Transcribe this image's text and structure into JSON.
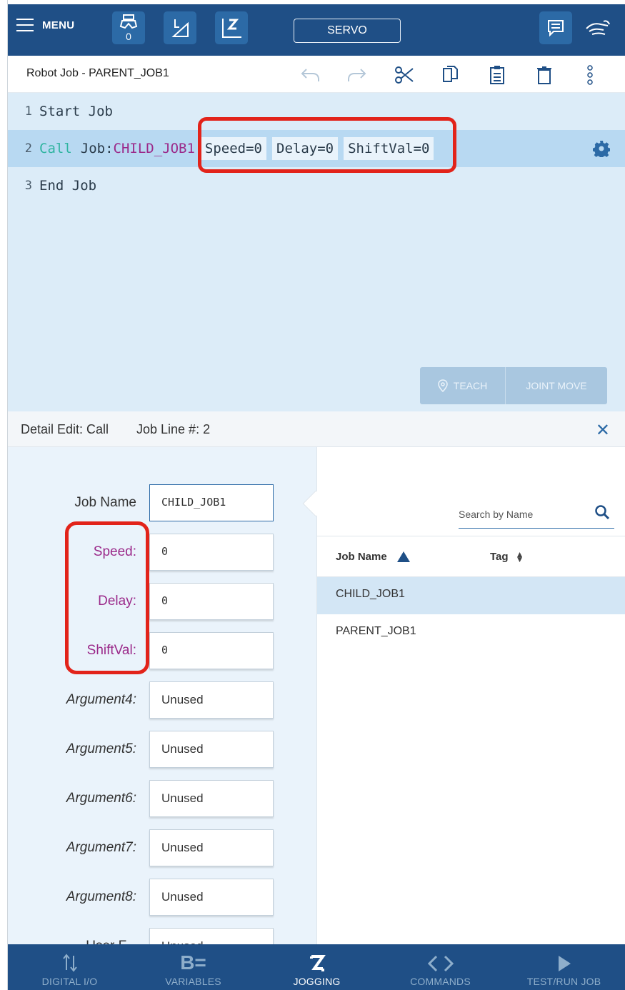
{
  "topbar": {
    "menu_label": "MENU",
    "tool_number": "0",
    "servo_label": "SERVO"
  },
  "jobbar": {
    "title": "Robot Job - PARENT_JOB1"
  },
  "editor": {
    "lines": [
      {
        "num": "1",
        "text": "Start Job"
      },
      {
        "num": "2",
        "keyword": "Call",
        "job_prefix": "Job:",
        "job_name": "CHILD_JOB1",
        "args": [
          "Speed=0",
          "Delay=0",
          "ShiftVal=0"
        ]
      },
      {
        "num": "3",
        "text": "End Job"
      }
    ],
    "teach_label": "TEACH",
    "joint_move_label": "JOINT MOVE"
  },
  "detail": {
    "title": "Detail Edit: Call",
    "job_line": "Job Line #: 2",
    "fields": [
      {
        "label": "Job Name",
        "value": "CHILD_JOB1"
      },
      {
        "label": "Speed:",
        "value": "0"
      },
      {
        "label": "Delay:",
        "value": "0"
      },
      {
        "label": "ShiftVal:",
        "value": "0"
      },
      {
        "label": "Argument4:",
        "value": "Unused"
      },
      {
        "label": "Argument5:",
        "value": "Unused"
      },
      {
        "label": "Argument6:",
        "value": "Unused"
      },
      {
        "label": "Argument7:",
        "value": "Unused"
      },
      {
        "label": "Argument8:",
        "value": "Unused"
      },
      {
        "label": "User F...",
        "value": "Unused"
      }
    ]
  },
  "job_list": {
    "search_placeholder": "Search by Name",
    "col_job_name": "Job Name",
    "col_tag": "Tag",
    "items": [
      "CHILD_JOB1",
      "PARENT_JOB1"
    ],
    "selected_index": 0
  },
  "bottomnav": {
    "items": [
      {
        "label": "DIGITAL I/O",
        "icon": "io-arrows-icon"
      },
      {
        "label": "VARIABLES",
        "icon": "variables-icon"
      },
      {
        "label": "JOGGING",
        "icon": "jogging-icon"
      },
      {
        "label": "COMMANDS",
        "icon": "code-brackets-icon"
      },
      {
        "label": "TEST/RUN JOB",
        "icon": "play-icon"
      }
    ],
    "active_index": 2
  },
  "colors": {
    "primary": "#1f4f86",
    "editor_bg": "#dcecf8",
    "selected_line": "#b8d9f2",
    "call_keyword": "#2fb4a0",
    "arg_label": "#9b2a8a",
    "annotation_red": "#e2231a"
  }
}
